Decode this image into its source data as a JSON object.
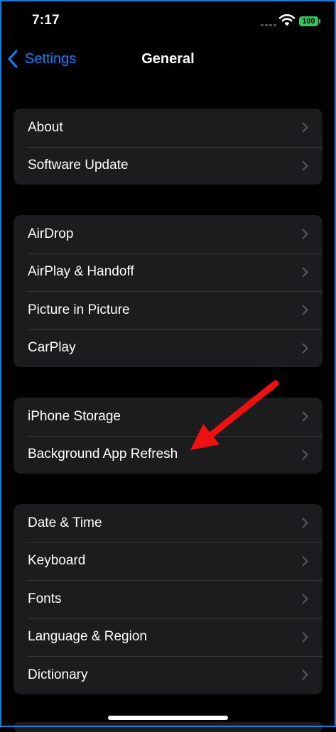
{
  "status_bar": {
    "time": "7:17",
    "battery": "100"
  },
  "nav": {
    "back_label": "Settings",
    "title": "General"
  },
  "groups": [
    {
      "rows": [
        "About",
        "Software Update"
      ]
    },
    {
      "rows": [
        "AirDrop",
        "AirPlay & Handoff",
        "Picture in Picture",
        "CarPlay"
      ]
    },
    {
      "rows": [
        "iPhone Storage",
        "Background App Refresh"
      ]
    },
    {
      "rows": [
        "Date & Time",
        "Keyboard",
        "Fonts",
        "Language & Region",
        "Dictionary"
      ]
    }
  ],
  "colors": {
    "accent": "#0a84ff",
    "annotation_arrow": "#ee1111",
    "battery": "#35c759",
    "cell_background": "#1c1c1e"
  },
  "annotation": {
    "type": "arrow",
    "points_to": "Background App Refresh"
  }
}
